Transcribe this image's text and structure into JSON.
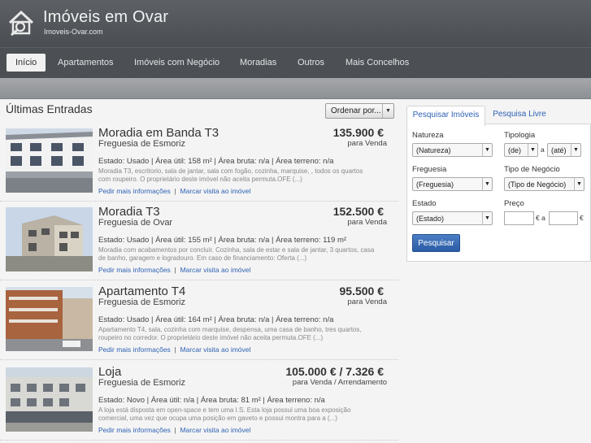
{
  "header": {
    "title": "Imóveis em Ovar",
    "subtitle": "Imoveis-Ovar.com",
    "logo_icon": "house-search-icon"
  },
  "nav": {
    "items": [
      {
        "label": "Início",
        "active": true
      },
      {
        "label": "Apartamentos",
        "active": false
      },
      {
        "label": "Imóveis com Negócio",
        "active": false
      },
      {
        "label": "Moradias",
        "active": false
      },
      {
        "label": "Outros",
        "active": false
      },
      {
        "label": "Mais Concelhos",
        "active": false
      }
    ]
  },
  "listings_section": {
    "title": "Últimas Entradas",
    "order_label": "Ordenar por..."
  },
  "listings": [
    {
      "title": "Moradia em Banda  T3",
      "parish": "Freguesia de Esmoriz",
      "price": "135.900 €",
      "price_type": "para Venda",
      "facts": "Estado: Usado  | Área útil: 158 m²  | Área bruta: n/a  | Área terreno: n/a",
      "desc": "Moradia T3, escritorio, sala de jantar, sala com fogão, cozinha, marquise, , todos os quartos com roupeiro. O proprietário deste imóvel não aceita permuta.OFE (...)",
      "link_info": "Pedir mais informações",
      "link_visit": "Marcar visita ao imóvel"
    },
    {
      "title": "Moradia  T3",
      "parish": "Freguesia de Ovar",
      "price": "152.500 €",
      "price_type": "para Venda",
      "facts": "Estado: Usado  | Área útil: 155 m²  | Área bruta: n/a  | Área terreno: 119 m²",
      "desc": "Moradia com acabamentos por concluir. Cozinha, sala de estar e sala de jantar, 3 quartos, casa de banho, garagem e logradouro. Em caso de financiamento: Oferta (...)",
      "link_info": "Pedir mais informações",
      "link_visit": "Marcar visita ao imóvel"
    },
    {
      "title": "Apartamento  T4",
      "parish": "Freguesia de Esmoriz",
      "price": "95.500 €",
      "price_type": "para Venda",
      "facts": "Estado: Usado  | Área útil: 164 m²  | Área bruta: n/a  | Área terreno: n/a",
      "desc": "Apartamento T4, sala, cozinha com marquise, despensa, uma casa de banho, tres quartos, roupeiro no corredor. O proprietário deste imóvel não aceita permuta.OFE (...)",
      "link_info": "Pedir mais informações",
      "link_visit": "Marcar visita ao imóvel"
    },
    {
      "title": "Loja",
      "parish": "Freguesia de Esmoriz",
      "price": "105.000 € / 7.326 €",
      "price_type": "para Venda / Arrendamento",
      "facts": "Estado: Novo  | Área útil: n/a  | Área bruta: 81 m²  | Área terreno: n/a",
      "desc": "A loja está disposta em open-space e tem uma I.S. Esta loja possui uma boa exposição comercial, uma vez que ocupa uma posição em gaveto e possui montra para a (...)",
      "link_info": "Pedir mais informações",
      "link_visit": "Marcar visita ao imóvel"
    }
  ],
  "search": {
    "tab_active": "Pesquisar Imóveis",
    "tab_inactive": "Pesquisa Livre",
    "natureza_label": "Natureza",
    "natureza_value": "(Natureza)",
    "tipologia_label": "Tipologia",
    "tipologia_from": "(de)",
    "tipologia_sep": "a",
    "tipologia_to": "(até)",
    "freguesia_label": "Freguesia",
    "freguesia_value": "(Freguesia)",
    "negocio_label": "Tipo de Negócio",
    "negocio_value": "(Tipo de Negócio)",
    "estado_label": "Estado",
    "estado_value": "(Estado)",
    "preco_label": "Preço",
    "preco_euro1": "€ a",
    "preco_euro2": "€",
    "button": "Pesquisar"
  },
  "colors": {
    "header_bg": "#4a4e53",
    "accent_blue": "#2f62b4",
    "button_blue": "#2b5ca5"
  }
}
